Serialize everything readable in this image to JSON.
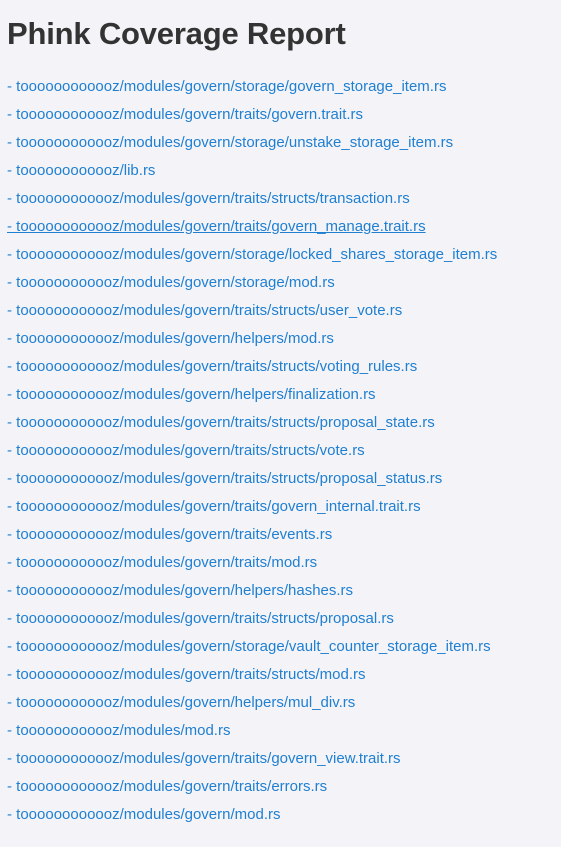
{
  "page": {
    "title": "Phink Coverage Report"
  },
  "files": [
    {
      "label": "- toooooooooooz/modules/govern/storage/govern_storage_item.rs",
      "hovered": false
    },
    {
      "label": "- toooooooooooz/modules/govern/traits/govern.trait.rs",
      "hovered": false
    },
    {
      "label": "- toooooooooooz/modules/govern/storage/unstake_storage_item.rs",
      "hovered": false
    },
    {
      "label": "- toooooooooooz/lib.rs",
      "hovered": false
    },
    {
      "label": "- toooooooooooz/modules/govern/traits/structs/transaction.rs",
      "hovered": false
    },
    {
      "label": "- toooooooooooz/modules/govern/traits/govern_manage.trait.rs",
      "hovered": true
    },
    {
      "label": "- toooooooooooz/modules/govern/storage/locked_shares_storage_item.rs",
      "hovered": false
    },
    {
      "label": "- toooooooooooz/modules/govern/storage/mod.rs",
      "hovered": false
    },
    {
      "label": "- toooooooooooz/modules/govern/traits/structs/user_vote.rs",
      "hovered": false
    },
    {
      "label": "- toooooooooooz/modules/govern/helpers/mod.rs",
      "hovered": false
    },
    {
      "label": "- toooooooooooz/modules/govern/traits/structs/voting_rules.rs",
      "hovered": false
    },
    {
      "label": "- toooooooooooz/modules/govern/helpers/finalization.rs",
      "hovered": false
    },
    {
      "label": "- toooooooooooz/modules/govern/traits/structs/proposal_state.rs",
      "hovered": false
    },
    {
      "label": "- toooooooooooz/modules/govern/traits/structs/vote.rs",
      "hovered": false
    },
    {
      "label": "- toooooooooooz/modules/govern/traits/structs/proposal_status.rs",
      "hovered": false
    },
    {
      "label": "- toooooooooooz/modules/govern/traits/govern_internal.trait.rs",
      "hovered": false
    },
    {
      "label": "- toooooooooooz/modules/govern/traits/events.rs",
      "hovered": false
    },
    {
      "label": "- toooooooooooz/modules/govern/traits/mod.rs",
      "hovered": false
    },
    {
      "label": "- toooooooooooz/modules/govern/helpers/hashes.rs",
      "hovered": false
    },
    {
      "label": "- toooooooooooz/modules/govern/traits/structs/proposal.rs",
      "hovered": false
    },
    {
      "label": "- toooooooooooz/modules/govern/storage/vault_counter_storage_item.rs",
      "hovered": false
    },
    {
      "label": "- toooooooooooz/modules/govern/traits/structs/mod.rs",
      "hovered": false
    },
    {
      "label": "- toooooooooooz/modules/govern/helpers/mul_div.rs",
      "hovered": false
    },
    {
      "label": "- toooooooooooz/modules/mod.rs",
      "hovered": false
    },
    {
      "label": "- toooooooooooz/modules/govern/traits/govern_view.trait.rs",
      "hovered": false
    },
    {
      "label": "- toooooooooooz/modules/govern/traits/errors.rs",
      "hovered": false
    },
    {
      "label": "- toooooooooooz/modules/govern/mod.rs",
      "hovered": false
    }
  ],
  "colors": {
    "background": "#f4f4f8",
    "heading": "#333333",
    "link": "#1f7fd1"
  }
}
